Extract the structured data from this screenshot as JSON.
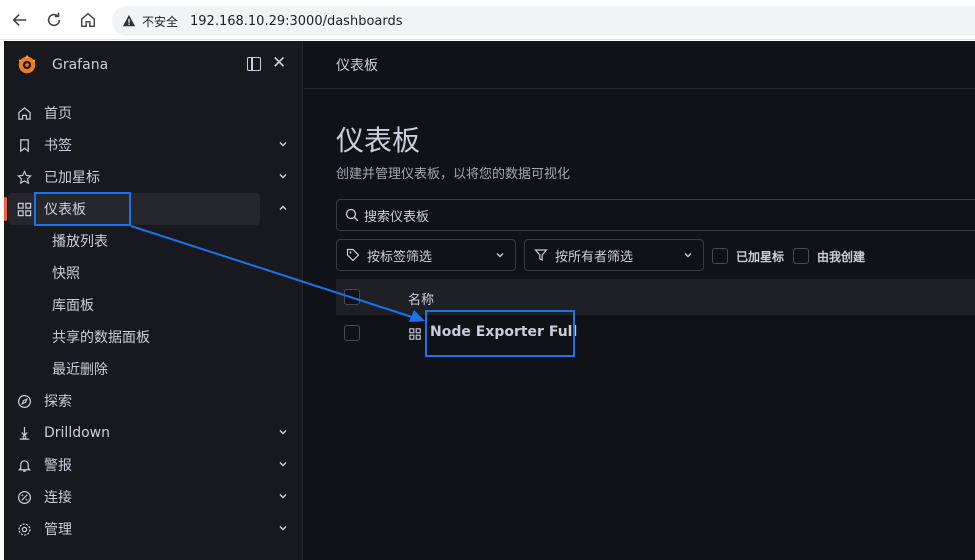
{
  "browser": {
    "security_label": "不安全",
    "url": "192.168.10.29:3000/dashboards"
  },
  "sidebar": {
    "brand": "Grafana",
    "items": [
      {
        "label": "首页",
        "icon": "home-icon"
      },
      {
        "label": "书签",
        "icon": "bookmark-icon"
      },
      {
        "label": "已加星标",
        "icon": "star-icon"
      },
      {
        "label": "仪表板",
        "icon": "apps-icon",
        "active": true
      },
      {
        "label": "探索",
        "icon": "compass-icon"
      },
      {
        "label": "Drilldown",
        "icon": "drilldown-icon"
      },
      {
        "label": "警报",
        "icon": "bell-icon"
      },
      {
        "label": "连接",
        "icon": "link-icon"
      },
      {
        "label": "管理",
        "icon": "cog-icon"
      }
    ],
    "sub_items": [
      "播放列表",
      "快照",
      "库面板",
      "共享的数据面板",
      "最近删除"
    ]
  },
  "main": {
    "breadcrumb": "仪表板",
    "title": "仪表板",
    "subtitle": "创建并管理仪表板，以将您的数据可视化",
    "search_placeholder": "搜索仪表板",
    "filter_tags": "按标签筛选",
    "filter_owner": "按所有者筛选",
    "check_starred": "已加星标",
    "check_mine": "由我创建",
    "column_name": "名称",
    "rows": [
      {
        "name": "Node Exporter Full"
      }
    ]
  },
  "colors": {
    "accent": "#f55f3e",
    "annotation": "#1a73e8",
    "background": "#111217",
    "sidebar": "#18191e"
  }
}
